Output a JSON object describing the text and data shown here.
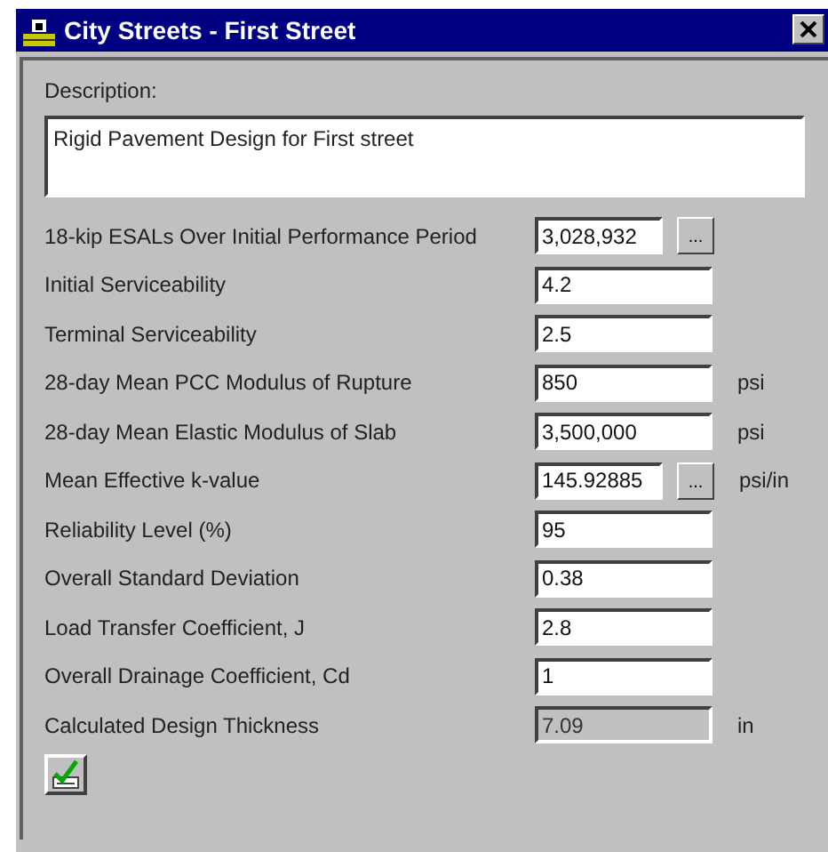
{
  "window": {
    "title": "City Streets - First Street"
  },
  "description": {
    "label": "Description:",
    "value": "Rigid Pavement Design for First street"
  },
  "fields": [
    {
      "label": "18-kip ESALs Over Initial Performance Period",
      "value": "3,028,932",
      "button": "...",
      "readonly": false
    },
    {
      "label": "Initial Serviceability",
      "value": "4.2",
      "readonly": false
    },
    {
      "label": "Terminal Serviceability",
      "value": "2.5",
      "readonly": false
    },
    {
      "label": "28-day Mean PCC Modulus of Rupture",
      "value": "850",
      "unit": "psi",
      "readonly": false
    },
    {
      "label": "28-day Mean Elastic Modulus of Slab",
      "value": "3,500,000",
      "unit": "psi",
      "readonly": false
    },
    {
      "label": "Mean Effective k-value",
      "value": "145.92885",
      "button": "...",
      "unit": "psi/in",
      "readonly": false
    },
    {
      "label": "Reliability Level (%)",
      "value": "95",
      "readonly": false
    },
    {
      "label": "Overall Standard Deviation",
      "value": "0.38",
      "readonly": false
    },
    {
      "label": "Load Transfer Coefficient, J",
      "value": "2.8",
      "readonly": false
    },
    {
      "label": "Overall Drainage Coefficient, Cd",
      "value": "1",
      "readonly": false
    },
    {
      "label": "Calculated Design Thickness",
      "value": "7.09",
      "unit": "in",
      "readonly": true
    }
  ]
}
